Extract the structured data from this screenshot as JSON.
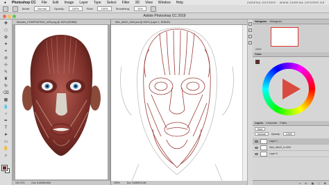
{
  "menubar": {
    "apple_icon": "apple-icon",
    "app": "Photoshop CC",
    "items": [
      "File",
      "Edit",
      "Image",
      "Layer",
      "Type",
      "Select",
      "Filter",
      "3D",
      "View",
      "Window",
      "Help"
    ],
    "brand": "ZARENA GESSER · WWW.ZARENA-GESSER.DE"
  },
  "options": {
    "mode_label": "Mode:",
    "mode_value": "Normal",
    "opacity_label": "Opacity:",
    "opacity_value": "100%",
    "flow_label": "Flow:",
    "flow_value": "100%",
    "smoothing_label": "Smoothing:",
    "smoothing_value": "10%"
  },
  "window": {
    "title": "Adobe Photoshop CC 2019"
  },
  "doc1": {
    "tab": "Muscles_COMPOSITING_v003.png @ 100% (RGB/8)",
    "zoom": "100,74%",
    "size": "Doc: 6,60M/6,60M"
  },
  "doc2": {
    "tab": "Skin_ABLE_v003.psd @ 200% (Layer 1, RGB/8*)",
    "zoom": "200%",
    "size": "Doc: 5,65M/10,0M"
  },
  "navigator": {
    "tabs": [
      "Navigator",
      "Histogram"
    ],
    "zoom": "200%"
  },
  "color": {
    "tabs": [
      "Color"
    ],
    "fg": "#6b2b25"
  },
  "layers": {
    "tabs": [
      "Layers",
      "Channels",
      "Paths"
    ],
    "kind": "Kind",
    "blend": "Normal",
    "opacity_label": "Opacity:",
    "opacity": "100%",
    "lock_label": "Lock:",
    "fill_label": "Fill:",
    "fill": "100%",
    "items": [
      {
        "name": "Layer 1",
        "selected": true
      },
      {
        "name": "Skin_ABLE_b.v003",
        "selected": false
      },
      {
        "name": "Layer 0",
        "selected": false
      }
    ]
  },
  "colors": {
    "muscle": "#8e3a33",
    "sketch": "#9b3b36",
    "accent": "#d94a3f"
  }
}
